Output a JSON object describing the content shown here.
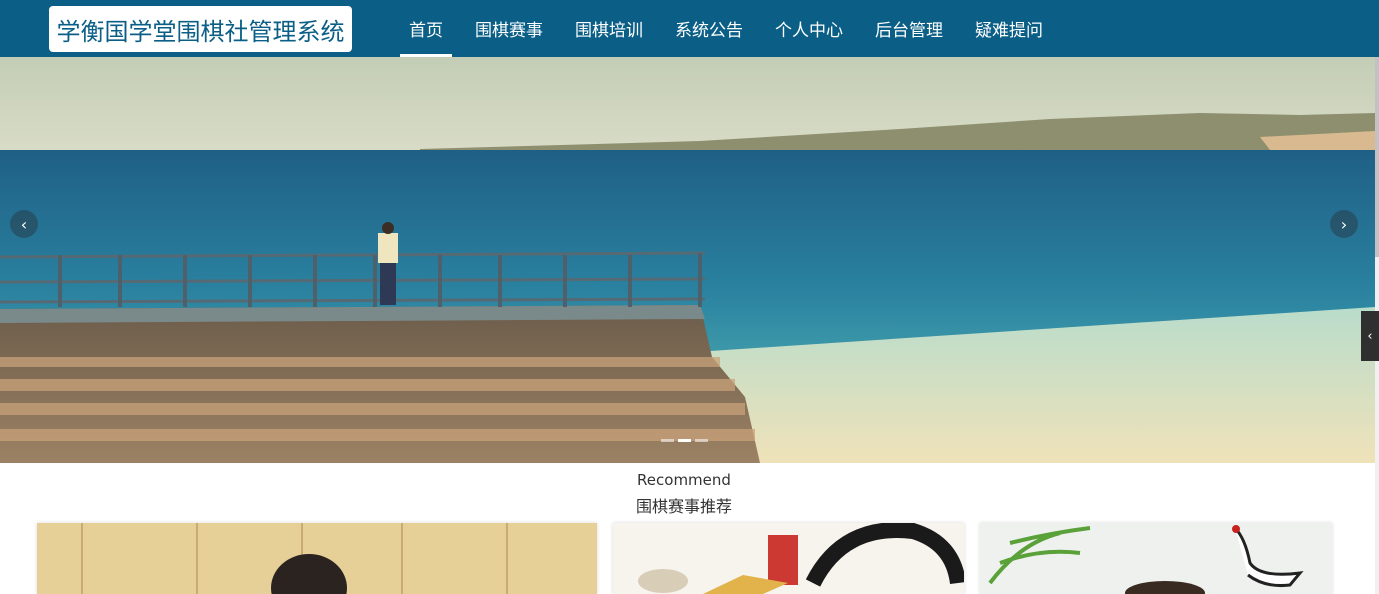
{
  "brand": {
    "title": "学衡国学堂围棋社管理系统"
  },
  "nav": {
    "items": [
      {
        "label": "首页",
        "active": true
      },
      {
        "label": "围棋赛事",
        "active": false
      },
      {
        "label": "围棋培训",
        "active": false
      },
      {
        "label": "系统公告",
        "active": false
      },
      {
        "label": "个人中心",
        "active": false
      },
      {
        "label": "后台管理",
        "active": false
      },
      {
        "label": "疑难提问",
        "active": false
      }
    ]
  },
  "banner": {
    "prev_icon": "chevron-left-icon",
    "next_icon": "chevron-right-icon",
    "prev_glyph": "‹",
    "next_glyph": "›",
    "slide_count": 3,
    "active_slide": 1
  },
  "side_panel": {
    "toggle_glyph": "‹"
  },
  "recommend": {
    "heading_en": "Recommend",
    "heading_cn": "围棋赛事推荐"
  },
  "colors": {
    "header_bg": "#0b5f86",
    "brand_bg": "#ffffff",
    "nav_text": "#ffffff"
  }
}
